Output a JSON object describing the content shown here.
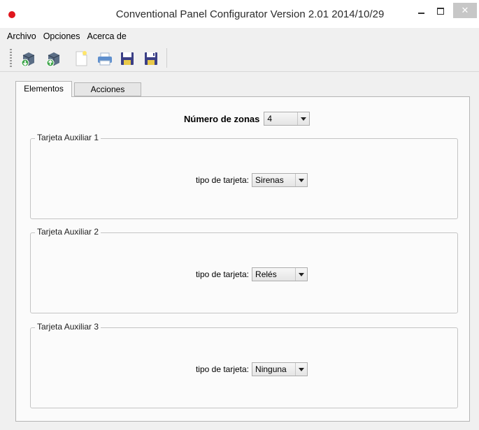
{
  "window": {
    "title": "Conventional Panel Configurator Version 2.01 2014/10/29",
    "close_glyph": "✕"
  },
  "menubar": {
    "items": [
      "Archivo",
      "Opciones",
      "Acerca de"
    ]
  },
  "toolbar": {
    "icons": [
      "upload-panel-icon",
      "download-panel-icon",
      "new-file-icon",
      "print-icon",
      "save-icon",
      "save-as-icon"
    ]
  },
  "tabs": [
    {
      "label": "Elementos",
      "active": true
    },
    {
      "label": "Acciones",
      "active": false
    }
  ],
  "zones": {
    "label": "Número de zonas",
    "value": "4"
  },
  "aux_cards": [
    {
      "title": "Tarjeta Auxiliar 1",
      "type_label": "tipo de tarjeta:",
      "type_value": "Sirenas"
    },
    {
      "title": "Tarjeta Auxiliar 2",
      "type_label": "tipo de tarjeta:",
      "type_value": "Relés"
    },
    {
      "title": "Tarjeta Auxiliar 3",
      "type_label": "tipo de tarjeta:",
      "type_value": "Ninguna"
    }
  ],
  "colors": {
    "app_icon": "#e0161d",
    "window_bg": "#f0f0f0",
    "panel_bg": "#fbfbfb"
  }
}
